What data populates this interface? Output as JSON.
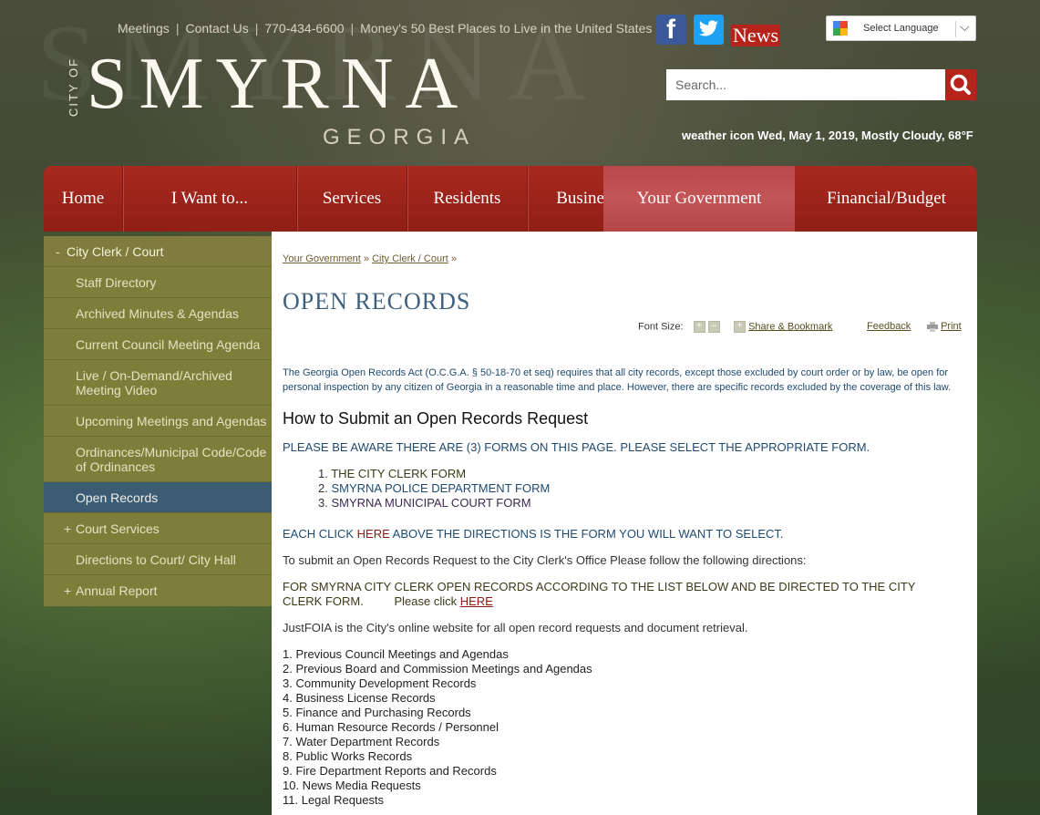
{
  "watermark": "SMYRNA",
  "top_links": {
    "meetings": "Meetings",
    "contact": "Contact Us",
    "phone": "770-434-6600",
    "money": "Money's 50 Best Places to Live in the United States",
    "separator": "|",
    "news": "News"
  },
  "social": {
    "facebook": "f"
  },
  "language": {
    "label": "Select Language",
    "chevron": "⌵"
  },
  "search": {
    "placeholder": "Search..."
  },
  "weather": {
    "icon_alt": "weather icon",
    "text": "Wed, May 1, 2019, Mostly Cloudy, 68°F"
  },
  "logo": {
    "city_of": "CITY OF",
    "name": "SMYRNA",
    "state": "GEORGIA"
  },
  "nav": [
    "Home",
    "I Want to...",
    "Services",
    "Residents",
    "Business",
    "Your Government",
    "Financial/Budget"
  ],
  "nav_active": "Your Government",
  "sidebar": {
    "top": {
      "mark": "-",
      "label": "City Clerk / Court"
    },
    "items": [
      {
        "label": "Staff Directory"
      },
      {
        "label": "Archived Minutes & Agendas"
      },
      {
        "label": "Current Council Meeting Agenda"
      },
      {
        "label": "Live / On-Demand/Archived Meeting Video"
      },
      {
        "label": "Upcoming Meetings and Agendas"
      },
      {
        "label": "Ordinances/Municipal Code/Code of Ordinances"
      },
      {
        "label": "Open Records"
      },
      {
        "label": "Court Services",
        "mark": "+"
      },
      {
        "label": "Directions to Court/ City Hall"
      },
      {
        "label": "Annual Report",
        "mark": "+"
      }
    ]
  },
  "breadcrumb": {
    "first": "Your Government",
    "second": "City Clerk / Court",
    "sep": "»"
  },
  "page_title": "OPEN RECORDS",
  "tools": {
    "font_size": "Font Size:",
    "plus": "+",
    "minus": "–",
    "share": "Share & Bookmark",
    "feedback": "Feedback",
    "print": "Print"
  },
  "intro": "The Georgia Open Records Act (O.C.G.A. § 50-18-70 et seq) requires that all city records, except those excluded by court order or by law, be open for personal inspection by any citizen of Georgia in a reasonable time and place. However, there are specific records excluded by the coverage of this law.",
  "howto_heading": "How to Submit an Open Records Request",
  "please_text": "PLEASE BE AWARE THERE ARE (3) FORMS ON THIS PAGE.  PLEASE SELECT THE APPROPRIATE FORM.",
  "forms": [
    {
      "num": "1.",
      "label": "THE CITY CLERK FORM",
      "color": "#3a3a18"
    },
    {
      "num": "2.",
      "label": "SMYRNA POLICE DEPARTMENT FORM",
      "color": "#1f4a70"
    },
    {
      "num": "3.",
      "label": "SMYRNA MUNICIPAL COURT FORM",
      "color": "#3b2a50"
    }
  ],
  "each_click": {
    "before": "EACH CLICK ",
    "here": "HERE",
    "after": " ABOVE THE DIRECTIONS IS THE FORM YOU WILL WANT TO SELECT."
  },
  "submit_text": "To submit an Open Records Request to the City Clerk's Office Please follow the following directions:",
  "for_smyrna": {
    "text": "FOR SMYRNA CITY CLERK OPEN RECORDS ACCORDING TO THE LIST BELOW AND BE DIRECTED TO THE CITY CLERK FORM.",
    "please": "Please click ",
    "link": "HERE"
  },
  "justfoia": "JustFOIA is the City's online website for all open record requests and document retrieval.",
  "records_list": [
    "1. Previous Council Meetings and Agendas",
    "2. Previous Board and Commission Meetings and Agendas",
    "3. Community Development Records",
    "4. Business License Records",
    "5. Finance and Purchasing Records",
    "6. Human Resource Records / Personnel",
    "7. Water Department Records",
    "8. Public Works Records",
    "9. Fire Department Reports and Records",
    "10. News Media Requests",
    "11. Legal Requests"
  ],
  "colors": {
    "nav_red": "#9c241a",
    "sidebar_olive": "#7d7e3a",
    "active_blue": "#3b5c73",
    "title_blue": "#3f607d"
  }
}
